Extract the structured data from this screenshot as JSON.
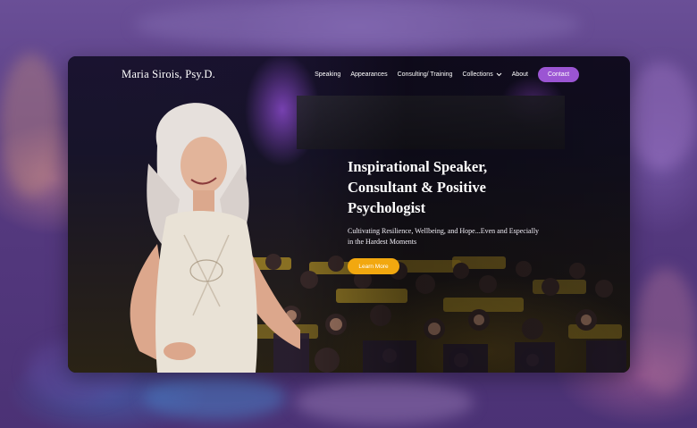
{
  "site": {
    "logo": "Maria Sirois, Psy.D."
  },
  "nav": {
    "items": [
      "Speaking",
      "Appearances",
      "Consulting/ Training",
      "Collections",
      "About"
    ],
    "contact_label": "Contact"
  },
  "hero": {
    "heading_lines": [
      "Inspirational Speaker,",
      "Consultant & Positive",
      "Psychologist"
    ],
    "subtitle": "Cultivating Resilience, Wellbeing, and Hope...Even and Especially in the Hardest Moments",
    "cta_label": "Learn More"
  },
  "colors": {
    "accent_purple": "#9b55d3",
    "cta_orange": "#f2a80f",
    "backdrop": "#5b3f86"
  },
  "icons": {
    "collections_dropdown": "chevron-down-icon"
  }
}
